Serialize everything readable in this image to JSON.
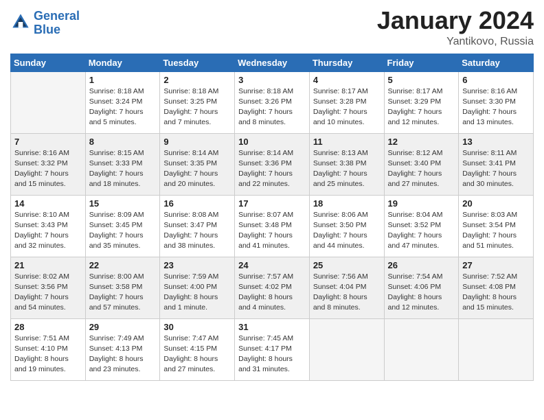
{
  "logo": {
    "line1": "General",
    "line2": "Blue"
  },
  "title": "January 2024",
  "location": "Yantikovo, Russia",
  "days_of_week": [
    "Sunday",
    "Monday",
    "Tuesday",
    "Wednesday",
    "Thursday",
    "Friday",
    "Saturday"
  ],
  "weeks": [
    [
      {
        "day": "",
        "info": ""
      },
      {
        "day": "1",
        "info": "Sunrise: 8:18 AM\nSunset: 3:24 PM\nDaylight: 7 hours\nand 5 minutes."
      },
      {
        "day": "2",
        "info": "Sunrise: 8:18 AM\nSunset: 3:25 PM\nDaylight: 7 hours\nand 7 minutes."
      },
      {
        "day": "3",
        "info": "Sunrise: 8:18 AM\nSunset: 3:26 PM\nDaylight: 7 hours\nand 8 minutes."
      },
      {
        "day": "4",
        "info": "Sunrise: 8:17 AM\nSunset: 3:28 PM\nDaylight: 7 hours\nand 10 minutes."
      },
      {
        "day": "5",
        "info": "Sunrise: 8:17 AM\nSunset: 3:29 PM\nDaylight: 7 hours\nand 12 minutes."
      },
      {
        "day": "6",
        "info": "Sunrise: 8:16 AM\nSunset: 3:30 PM\nDaylight: 7 hours\nand 13 minutes."
      }
    ],
    [
      {
        "day": "7",
        "info": "Sunrise: 8:16 AM\nSunset: 3:32 PM\nDaylight: 7 hours\nand 15 minutes."
      },
      {
        "day": "8",
        "info": "Sunrise: 8:15 AM\nSunset: 3:33 PM\nDaylight: 7 hours\nand 18 minutes."
      },
      {
        "day": "9",
        "info": "Sunrise: 8:14 AM\nSunset: 3:35 PM\nDaylight: 7 hours\nand 20 minutes."
      },
      {
        "day": "10",
        "info": "Sunrise: 8:14 AM\nSunset: 3:36 PM\nDaylight: 7 hours\nand 22 minutes."
      },
      {
        "day": "11",
        "info": "Sunrise: 8:13 AM\nSunset: 3:38 PM\nDaylight: 7 hours\nand 25 minutes."
      },
      {
        "day": "12",
        "info": "Sunrise: 8:12 AM\nSunset: 3:40 PM\nDaylight: 7 hours\nand 27 minutes."
      },
      {
        "day": "13",
        "info": "Sunrise: 8:11 AM\nSunset: 3:41 PM\nDaylight: 7 hours\nand 30 minutes."
      }
    ],
    [
      {
        "day": "14",
        "info": "Sunrise: 8:10 AM\nSunset: 3:43 PM\nDaylight: 7 hours\nand 32 minutes."
      },
      {
        "day": "15",
        "info": "Sunrise: 8:09 AM\nSunset: 3:45 PM\nDaylight: 7 hours\nand 35 minutes."
      },
      {
        "day": "16",
        "info": "Sunrise: 8:08 AM\nSunset: 3:47 PM\nDaylight: 7 hours\nand 38 minutes."
      },
      {
        "day": "17",
        "info": "Sunrise: 8:07 AM\nSunset: 3:48 PM\nDaylight: 7 hours\nand 41 minutes."
      },
      {
        "day": "18",
        "info": "Sunrise: 8:06 AM\nSunset: 3:50 PM\nDaylight: 7 hours\nand 44 minutes."
      },
      {
        "day": "19",
        "info": "Sunrise: 8:04 AM\nSunset: 3:52 PM\nDaylight: 7 hours\nand 47 minutes."
      },
      {
        "day": "20",
        "info": "Sunrise: 8:03 AM\nSunset: 3:54 PM\nDaylight: 7 hours\nand 51 minutes."
      }
    ],
    [
      {
        "day": "21",
        "info": "Sunrise: 8:02 AM\nSunset: 3:56 PM\nDaylight: 7 hours\nand 54 minutes."
      },
      {
        "day": "22",
        "info": "Sunrise: 8:00 AM\nSunset: 3:58 PM\nDaylight: 7 hours\nand 57 minutes."
      },
      {
        "day": "23",
        "info": "Sunrise: 7:59 AM\nSunset: 4:00 PM\nDaylight: 8 hours\nand 1 minute."
      },
      {
        "day": "24",
        "info": "Sunrise: 7:57 AM\nSunset: 4:02 PM\nDaylight: 8 hours\nand 4 minutes."
      },
      {
        "day": "25",
        "info": "Sunrise: 7:56 AM\nSunset: 4:04 PM\nDaylight: 8 hours\nand 8 minutes."
      },
      {
        "day": "26",
        "info": "Sunrise: 7:54 AM\nSunset: 4:06 PM\nDaylight: 8 hours\nand 12 minutes."
      },
      {
        "day": "27",
        "info": "Sunrise: 7:52 AM\nSunset: 4:08 PM\nDaylight: 8 hours\nand 15 minutes."
      }
    ],
    [
      {
        "day": "28",
        "info": "Sunrise: 7:51 AM\nSunset: 4:10 PM\nDaylight: 8 hours\nand 19 minutes."
      },
      {
        "day": "29",
        "info": "Sunrise: 7:49 AM\nSunset: 4:13 PM\nDaylight: 8 hours\nand 23 minutes."
      },
      {
        "day": "30",
        "info": "Sunrise: 7:47 AM\nSunset: 4:15 PM\nDaylight: 8 hours\nand 27 minutes."
      },
      {
        "day": "31",
        "info": "Sunrise: 7:45 AM\nSunset: 4:17 PM\nDaylight: 8 hours\nand 31 minutes."
      },
      {
        "day": "",
        "info": ""
      },
      {
        "day": "",
        "info": ""
      },
      {
        "day": "",
        "info": ""
      }
    ]
  ]
}
